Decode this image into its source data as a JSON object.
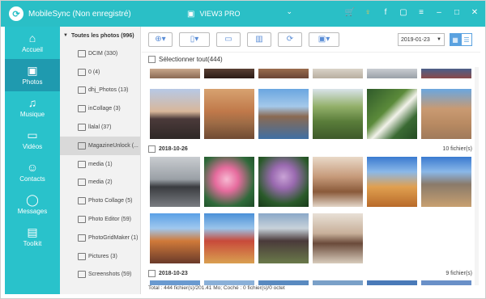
{
  "app": {
    "title": "MobileSync (Non enregistré)",
    "device": "VIEW3 PRO"
  },
  "titlebar_icons": [
    "cart-icon",
    "key-icon",
    "facebook-icon",
    "chat-icon",
    "menu-icon",
    "minimize-icon",
    "maximize-icon",
    "close-icon"
  ],
  "nav": [
    {
      "label": "Accueil",
      "icon": "home-icon"
    },
    {
      "label": "Photos",
      "icon": "photos-icon"
    },
    {
      "label": "Musique",
      "icon": "music-icon"
    },
    {
      "label": "Vidéos",
      "icon": "video-icon"
    },
    {
      "label": "Contacts",
      "icon": "contacts-icon"
    },
    {
      "label": "Messages",
      "icon": "messages-icon"
    },
    {
      "label": "Toolkit",
      "icon": "toolkit-icon"
    }
  ],
  "albums": {
    "header": "Toutes les photos (996)",
    "items": [
      "DCIM (330)",
      "0 (4)",
      "dhj_Photos (13)",
      "inCollage (3)",
      "llalal (37)",
      "MagazineUnlock (...",
      "media (1)",
      "media (2)",
      "Photo Collage (5)",
      "Photo Editor (59)",
      "PhotoGridMaker (1)",
      "Pictures (3)",
      "Screenshots (59)"
    ]
  },
  "toolbar": {
    "date": "2019-01-23"
  },
  "select_all": "Sélectionner tout(444)",
  "groups": [
    {
      "date": "2018-10-26",
      "count": "10 fichier(s)"
    },
    {
      "date": "2018-10-23",
      "count": "9 fichier(s)"
    }
  ],
  "status": "Total : 444 fichier(s)/201.41 Mo; Coché : 0 fichier(s)/0 octet",
  "colors": {
    "accent": "#2abfc6",
    "nav_active": "#1f9aaf",
    "button_blue": "#5a8dd6"
  }
}
